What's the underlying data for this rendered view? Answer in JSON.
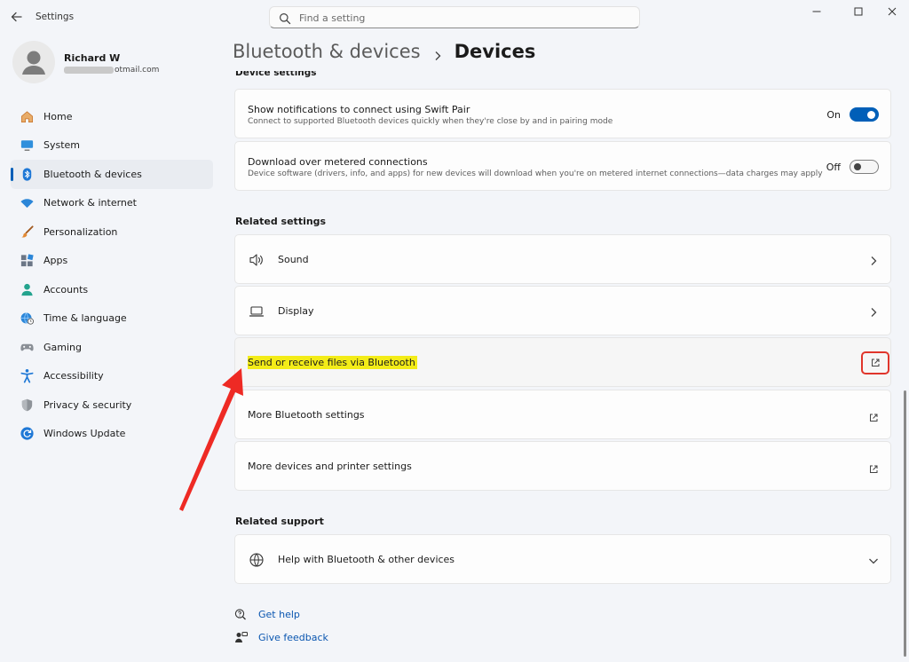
{
  "window": {
    "title": "Settings"
  },
  "search": {
    "placeholder": "Find a setting"
  },
  "profile": {
    "name": "Richard W",
    "email_visible": "otmail.com"
  },
  "nav": [
    {
      "label": "Home",
      "icon": "home-icon"
    },
    {
      "label": "System",
      "icon": "monitor-icon"
    },
    {
      "label": "Bluetooth & devices",
      "icon": "bluetooth-icon",
      "active": true
    },
    {
      "label": "Network & internet",
      "icon": "wifi-icon"
    },
    {
      "label": "Personalization",
      "icon": "brush-icon"
    },
    {
      "label": "Apps",
      "icon": "apps-icon"
    },
    {
      "label": "Accounts",
      "icon": "person-icon"
    },
    {
      "label": "Time & language",
      "icon": "globe-clock-icon"
    },
    {
      "label": "Gaming",
      "icon": "gamepad-icon"
    },
    {
      "label": "Accessibility",
      "icon": "accessibility-icon"
    },
    {
      "label": "Privacy & security",
      "icon": "shield-icon"
    },
    {
      "label": "Windows Update",
      "icon": "update-icon"
    }
  ],
  "breadcrumb": {
    "parent": "Bluetooth & devices",
    "current": "Devices"
  },
  "device_settings": {
    "section_label": "Device settings",
    "swift_pair": {
      "title": "Show notifications to connect using Swift Pair",
      "subtitle": "Connect to supported Bluetooth devices quickly when they're close by and in pairing mode",
      "state_label": "On",
      "on": true
    },
    "metered": {
      "title": "Download over metered connections",
      "subtitle": "Device software (drivers, info, and apps) for new devices will download when you're on metered internet connections—data charges may apply",
      "state_label": "Off",
      "on": false
    }
  },
  "related_settings": {
    "section_label": "Related settings",
    "sound": "Sound",
    "display": "Display",
    "send_receive": "Send or receive files via Bluetooth",
    "more_bluetooth": "More Bluetooth settings",
    "more_devices": "More devices and printer settings"
  },
  "related_support": {
    "section_label": "Related support",
    "help": "Help with Bluetooth & other devices"
  },
  "footer": {
    "get_help": "Get help",
    "give_feedback": "Give feedback"
  },
  "colors": {
    "accent": "#005fb8",
    "highlight": "#f3ec18",
    "annotation_red": "#e0352b"
  }
}
